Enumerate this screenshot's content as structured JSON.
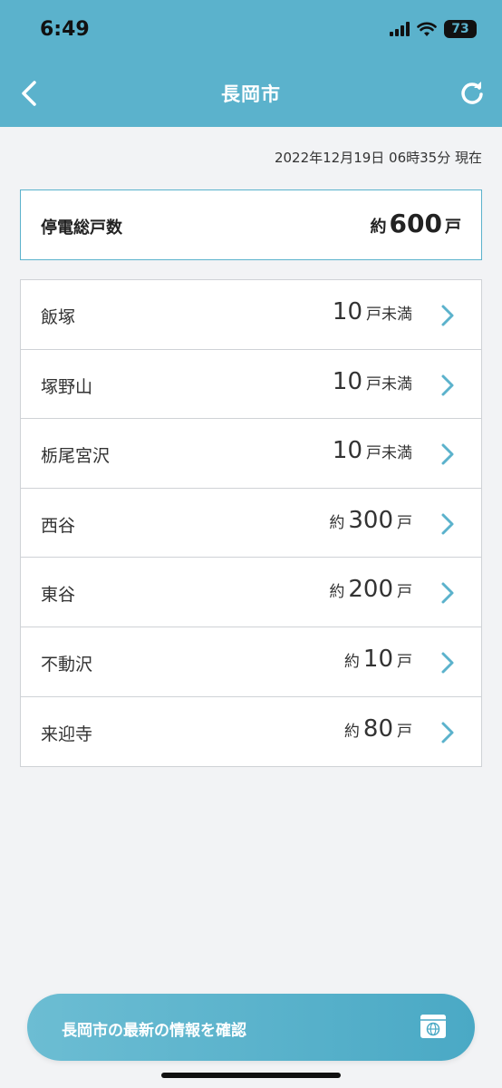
{
  "status_bar": {
    "time": "6:49",
    "battery": "73"
  },
  "nav": {
    "title": "長岡市"
  },
  "timestamp": "2022年12月19日 06時35分 現在",
  "total": {
    "label": "停電総戸数",
    "prefix": "約",
    "value": "600",
    "unit": "戸"
  },
  "areas": [
    {
      "name": "飯塚",
      "prefix": "",
      "value": "10",
      "unit": "戸未満"
    },
    {
      "name": "塚野山",
      "prefix": "",
      "value": "10",
      "unit": "戸未満"
    },
    {
      "name": "栃尾宮沢",
      "prefix": "",
      "value": "10",
      "unit": "戸未満"
    },
    {
      "name": "西谷",
      "prefix": "約",
      "value": "300",
      "unit": "戸"
    },
    {
      "name": "東谷",
      "prefix": "約",
      "value": "200",
      "unit": "戸"
    },
    {
      "name": "不動沢",
      "prefix": "約",
      "value": "10",
      "unit": "戸"
    },
    {
      "name": "来迎寺",
      "prefix": "約",
      "value": "80",
      "unit": "戸"
    }
  ],
  "bottom_button": {
    "label": "長岡市の最新の情報を確認",
    "icon": "web-browser-icon"
  },
  "colors": {
    "accent": "#5bb2cc",
    "background": "#f2f3f5"
  }
}
